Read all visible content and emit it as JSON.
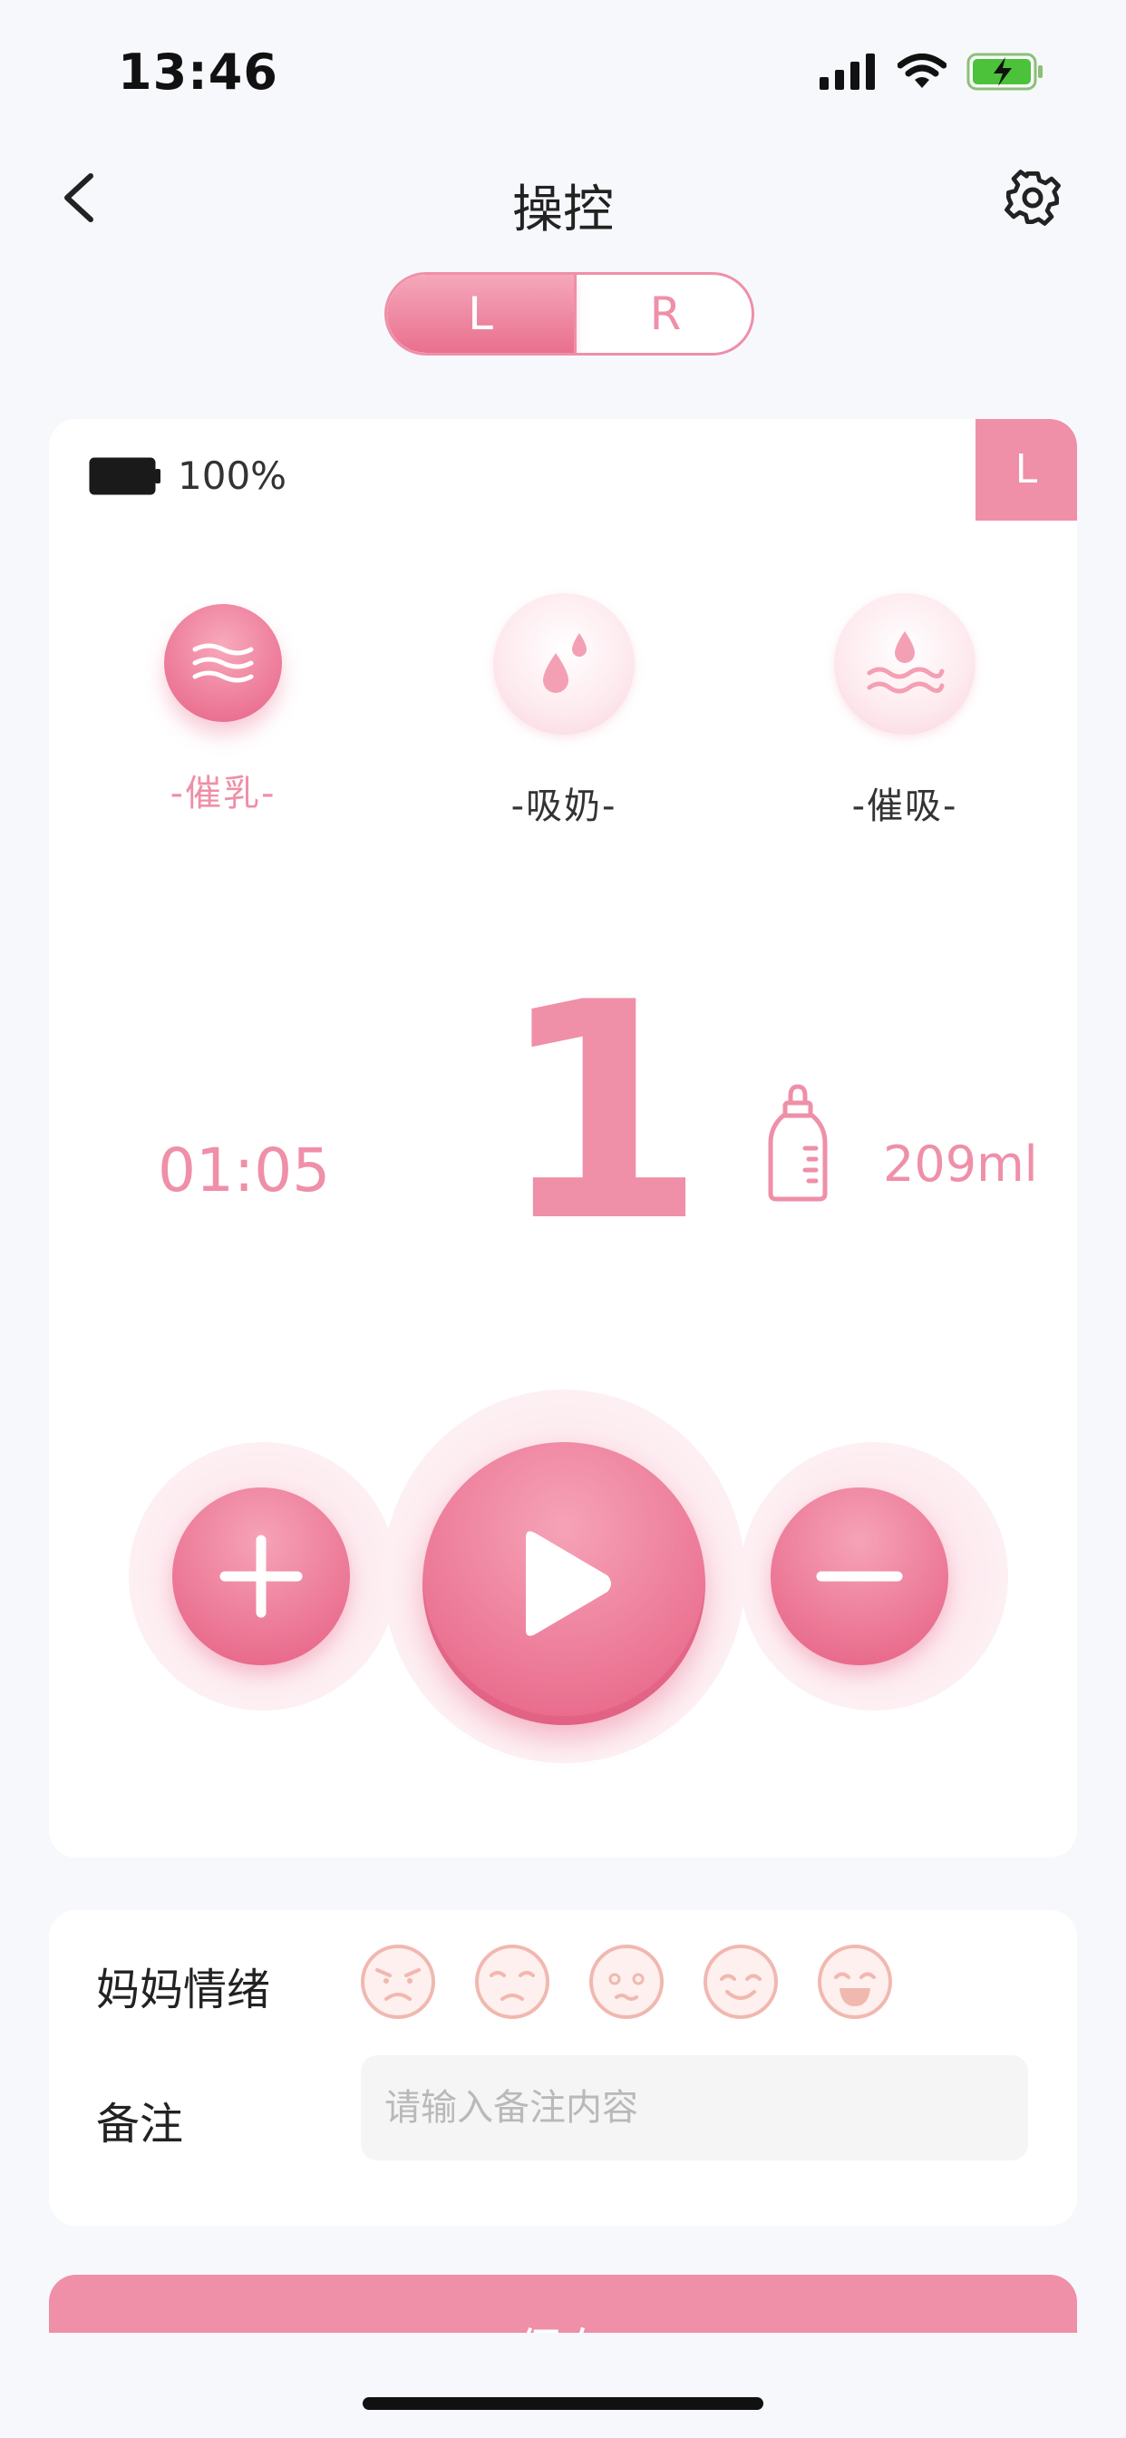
{
  "status_bar": {
    "time": "13:46"
  },
  "header": {
    "title": "操控",
    "back_icon": "chevron-left-icon",
    "settings_icon": "gear-icon"
  },
  "side_toggle": {
    "left_label": "L",
    "right_label": "R",
    "selected": "L"
  },
  "device": {
    "battery_text": "100%",
    "side_badge": "L"
  },
  "modes": [
    {
      "label": "-催乳-",
      "icon": "waves-icon",
      "active": true
    },
    {
      "label": "-吸奶-",
      "icon": "drops-icon",
      "active": false
    },
    {
      "label": "-催吸-",
      "icon": "drop-waves-icon",
      "active": false
    }
  ],
  "session": {
    "timer": "01:05",
    "level": "1",
    "volume": "209ml"
  },
  "controls": {
    "increase_icon": "plus-icon",
    "play_icon": "play-icon",
    "decrease_icon": "minus-icon"
  },
  "mood": {
    "label": "妈妈情绪",
    "faces": [
      "angry-face-icon",
      "upset-face-icon",
      "worried-face-icon",
      "smile-face-icon",
      "laugh-face-icon"
    ]
  },
  "note": {
    "label": "备注",
    "placeholder": "请输入备注内容",
    "value": ""
  },
  "save_label": "保存",
  "colors": {
    "accent": "#ef8fa8",
    "background": "#f7f8fc"
  }
}
